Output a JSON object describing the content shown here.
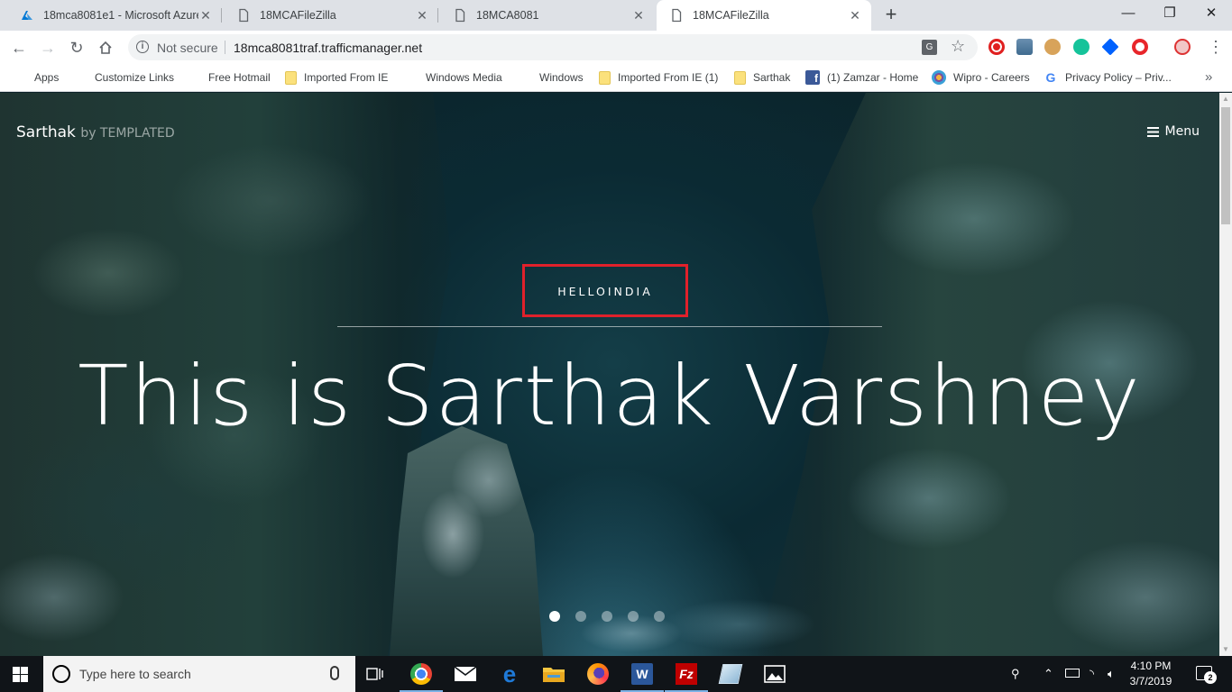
{
  "browser": {
    "tabs": [
      {
        "title": "18mca8081e1 - Microsoft Azure",
        "active": false
      },
      {
        "title": "18MCAFileZilla",
        "active": false
      },
      {
        "title": "18MCA8081",
        "active": false
      },
      {
        "title": "18MCAFileZilla",
        "active": true
      }
    ],
    "new_tab_icon": "plus-icon",
    "address_bar": {
      "security_label": "Not secure",
      "url": "18mca8081traf.trafficmanager.net"
    }
  },
  "bookmarks": [
    {
      "label": "Apps",
      "icon": "apps-grid-icon"
    },
    {
      "label": "Customize Links",
      "icon": "microsoft-logo-icon"
    },
    {
      "label": "Free Hotmail",
      "icon": "microsoft-logo-icon"
    },
    {
      "label": "Imported From IE",
      "icon": "folder-icon"
    },
    {
      "label": "Windows Media",
      "icon": "microsoft-logo-icon"
    },
    {
      "label": "Windows",
      "icon": "microsoft-logo-icon"
    },
    {
      "label": "Imported From IE (1)",
      "icon": "folder-icon"
    },
    {
      "label": "Sarthak",
      "icon": "folder-icon"
    },
    {
      "label": "(1) Zamzar - Home",
      "icon": "facebook-icon"
    },
    {
      "label": "Wipro - Careers",
      "icon": "wipro-icon"
    },
    {
      "label": "Privacy Policy – Priv...",
      "icon": "google-icon"
    }
  ],
  "site": {
    "logo_name": "Sarthak",
    "logo_by": "by TEMPLATED",
    "menu_label": "Menu",
    "hero_kicker": "HELLOINDIA",
    "hero_title": "This is Sarthak Varshney",
    "slide_count": 5,
    "active_slide": 1,
    "highlight_color": "#e0212b"
  },
  "taskbar": {
    "search_placeholder": "Type here to search",
    "time": "4:10 PM",
    "date": "3/7/2019",
    "notification_count": "2"
  }
}
